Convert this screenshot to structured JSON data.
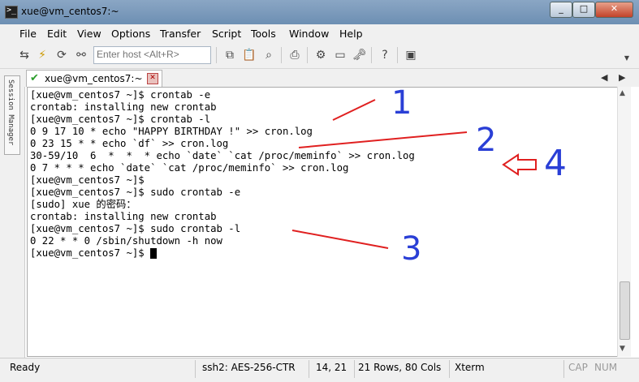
{
  "window": {
    "title": "xue@vm_centos7:~"
  },
  "menu": [
    "File",
    "Edit",
    "View",
    "Options",
    "Transfer",
    "Script",
    "Tools",
    "Window",
    "Help"
  ],
  "toolbar": {
    "host_placeholder": "Enter host <Alt+R>"
  },
  "sidebar": {
    "label": "Session Manager"
  },
  "tab": {
    "label": "xue@vm_centos7:~"
  },
  "terminal": {
    "lines": [
      "[xue@vm_centos7 ~]$ crontab -e",
      "crontab: installing new crontab",
      "[xue@vm_centos7 ~]$ crontab -l",
      "0 9 17 10 * echo \"HAPPY BIRTHDAY !\" >> cron.log",
      "0 23 15 * * echo `df` >> cron.log",
      "30-59/10  6  *  *  * echo `date` `cat /proc/meminfo` >> cron.log",
      "0 7 * * * echo `date` `cat /proc/meminfo` >> cron.log",
      "[xue@vm_centos7 ~]$",
      "[xue@vm_centos7 ~]$ sudo crontab -e",
      "[sudo] xue 的密码：",
      "crontab: installing new crontab",
      "[xue@vm_centos7 ~]$ sudo crontab -l",
      "0 22 * * 0 /sbin/shutdown -h now",
      "[xue@vm_centos7 ~]$ "
    ]
  },
  "annotations": {
    "n1": "1",
    "n2": "2",
    "n3": "3",
    "n4": "4",
    "color_blue": "#2a3fd6",
    "color_red": "#e02020"
  },
  "status": {
    "ready": "Ready",
    "cipher": "ssh2: AES-256-CTR",
    "position": "14,  21",
    "size": "21 Rows, 80 Cols",
    "term": "Xterm",
    "cap": "CAP",
    "num": "NUM"
  }
}
